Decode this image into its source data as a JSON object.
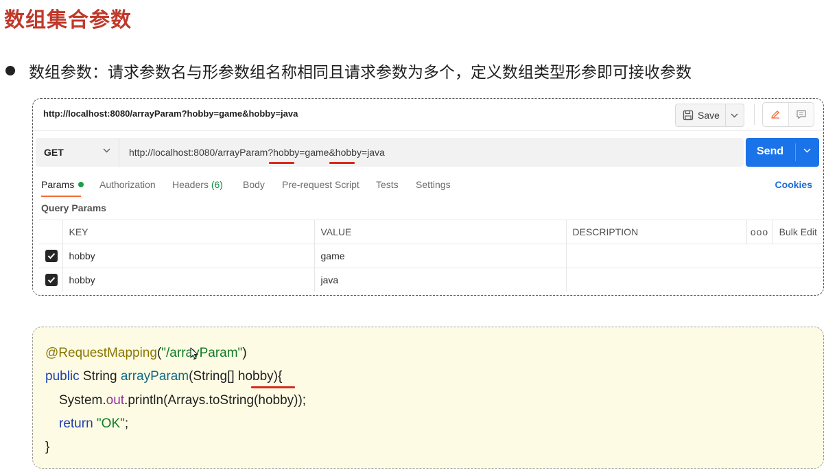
{
  "slide": {
    "title": "数组集合参数",
    "bullet": "数组参数：请求参数名与形参数组名称相同且请求参数为多个，定义数组类型形参即可接收参数"
  },
  "postman": {
    "top_url": "http://localhost:8080/arrayParam?hobby=game&hobby=java",
    "save_label": "Save",
    "method": "GET",
    "request_url": "http://localhost:8080/arrayParam?hobby=game&hobby=java",
    "send_label": "Send",
    "tabs": {
      "params": "Params",
      "authorization": "Authorization",
      "headers": "Headers",
      "headers_count": "(6)",
      "body": "Body",
      "prerequest": "Pre-request Script",
      "tests": "Tests",
      "settings": "Settings"
    },
    "cookies_label": "Cookies",
    "query_params_label": "Query Params",
    "table": {
      "headers": {
        "key": "KEY",
        "value": "VALUE",
        "description": "DESCRIPTION",
        "more": "ooo",
        "bulk_edit": "Bulk Edit"
      },
      "rows": [
        {
          "key": "hobby",
          "value": "game",
          "checked": true
        },
        {
          "key": "hobby",
          "value": "java",
          "checked": true
        }
      ]
    },
    "colors": {
      "send": "#1a73e8",
      "active_tab_underline": "#f26b3a",
      "highlight": "#d9291c"
    }
  },
  "code": {
    "l1_annotation": "@RequestMapping",
    "l1_open": "(",
    "l1_string": "\"/arrayParam\"",
    "l1_close": ")",
    "l2_public": "public",
    "l2_type": " String ",
    "l2_method": "arrayParam",
    "l2_params": "(String[] hobby){",
    "l3_system": "System.",
    "l3_out": "out",
    "l3_rest": ".println(Arrays.toString(hobby));",
    "l4_return": "return",
    "l4_string": " \"OK\"",
    "l4_end": ";",
    "l5": "}"
  }
}
